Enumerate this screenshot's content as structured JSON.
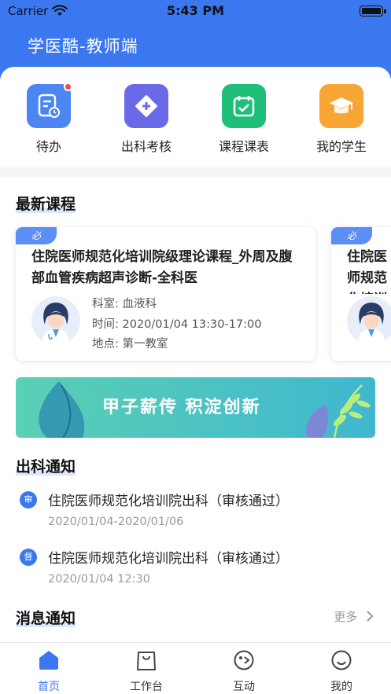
{
  "status_bar": {
    "carrier": "Carrier",
    "time": "5:43 PM"
  },
  "header": {
    "title": "学医酷-教师端"
  },
  "quick_actions": [
    {
      "label": "待办",
      "icon": "todo-icon",
      "color": "#4b86f2",
      "has_dot": true
    },
    {
      "label": "出科考核",
      "icon": "exam-icon",
      "color": "#6a6ae8"
    },
    {
      "label": "课程课表",
      "icon": "calendar-icon",
      "color": "#1fbf7a"
    },
    {
      "label": "我的学生",
      "icon": "graduation-cap-icon",
      "color": "#f7a535"
    }
  ],
  "latest_courses": {
    "title": "最新课程",
    "cards": [
      {
        "badge": "必",
        "title": "住院医师规范化培训院级理论课程_外周及腹部血管疾病超声诊断-全科医",
        "dept_label": "科室:",
        "dept": "血液科",
        "time_label": "时间:",
        "time": "2020/01/04  13:30-17:00",
        "place_label": "地点:",
        "place": "第一教室"
      },
      {
        "badge": "必",
        "title": "住院医师规范化培训院级理论课程及腹部血管疾病超声诊断"
      }
    ]
  },
  "banner": {
    "text": "甲子薪传  积淀创新"
  },
  "rotation_notices": {
    "title": "出科通知",
    "items": [
      {
        "tag": "审",
        "title": "住院医师规范化培训院出科（审核通过）",
        "time": "2020/01/04-2020/01/06"
      },
      {
        "tag": "督",
        "title": "住院医师规范化培训院出科（审核通过）",
        "time": "2020/01/04 12:30"
      }
    ]
  },
  "messages": {
    "title": "消息通知",
    "more": "更多"
  },
  "tabbar": [
    {
      "label": "首页",
      "icon": "home-icon",
      "active": true
    },
    {
      "label": "工作台",
      "icon": "bag-icon"
    },
    {
      "label": "互动",
      "icon": "interact-icon"
    },
    {
      "label": "我的",
      "icon": "smile-icon"
    }
  ],
  "colors": {
    "primary": "#3b78f0",
    "muted": "#999999"
  }
}
